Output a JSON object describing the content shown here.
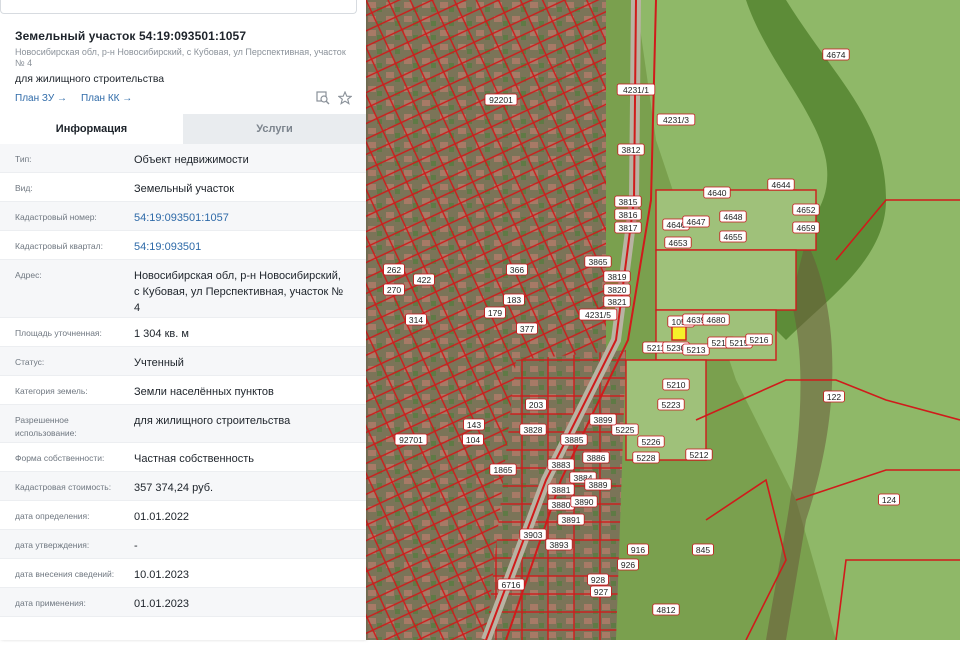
{
  "parcel": {
    "title": "Земельный участок 54:19:093501:1057",
    "address_line": "Новосибирская обл, р-н Новосибирский, с Кубовая, ул Перспективная, участок № 4",
    "purpose": "для жилищного строительства",
    "plan_zu": "План ЗУ →",
    "plan_kk": "План КК →"
  },
  "tabs": [
    {
      "label": "Информация"
    },
    {
      "label": "Услуги"
    }
  ],
  "rows": [
    {
      "label": "Тип:",
      "value": "Объект недвижимости"
    },
    {
      "label": "Вид:",
      "value": "Земельный участок"
    },
    {
      "label": "Кадастровый номер:",
      "value": "54:19:093501:1057"
    },
    {
      "label": "Кадастровый квартал:",
      "value": "54:19:093501"
    },
    {
      "label": "Адрес:",
      "value": "Новосибирская обл, р-н Новосибирский, с Кубовая, ул Перспективная, участок № 4"
    },
    {
      "label": "Площадь уточненная:",
      "value": "1 304 кв. м"
    },
    {
      "label": "Статус:",
      "value": "Учтенный"
    },
    {
      "label": "Категория земель:",
      "value": "Земли населённых пунктов"
    },
    {
      "label": "Разрешенное использование:",
      "value": "для жилищного строительства"
    },
    {
      "label": "Форма собственности:",
      "value": "Частная собственность"
    },
    {
      "label": "Кадастровая стоимость:",
      "value": "357 374,24 руб."
    },
    {
      "label": "дата определения:",
      "value": "01.01.2022"
    },
    {
      "label": "дата утверждения:",
      "value": "-"
    },
    {
      "label": "дата внесения сведений:",
      "value": "10.01.2023"
    },
    {
      "label": "дата применения:",
      "value": "01.01.2023"
    }
  ],
  "map_labels": [
    "4674",
    "4231/1",
    "4231/3",
    "3812",
    "92201",
    "3815",
    "3816",
    "3817",
    "3819",
    "3820",
    "3821",
    "3865",
    "4640",
    "4644",
    "4648",
    "4652",
    "4646",
    "4647",
    "4653",
    "4655",
    "4659",
    "1057",
    "4639",
    "4680",
    "5211",
    "5230",
    "5213",
    "5214",
    "5215",
    "5216",
    "5210",
    "5223",
    "5225",
    "5226",
    "5228",
    "5212",
    "122",
    "124",
    "845",
    "3885",
    "3886",
    "3883",
    "3884",
    "3889",
    "3881",
    "3880",
    "3890",
    "3891",
    "3828",
    "3899",
    "3893",
    "3903",
    "4812",
    "366",
    "314",
    "183",
    "179",
    "377",
    "203",
    "143",
    "104",
    "92701",
    "4231/5",
    "422",
    "262",
    "270",
    "1865",
    "6716",
    "916",
    "926",
    "927",
    "928"
  ],
  "colors": {
    "accent": "#2e6aa8",
    "parcel_border": "#c8151b",
    "selected_parcel": "#f6f02a",
    "vegetation": "#6f9f43"
  },
  "icons": [
    "search-plan-icon",
    "star-icon"
  ]
}
